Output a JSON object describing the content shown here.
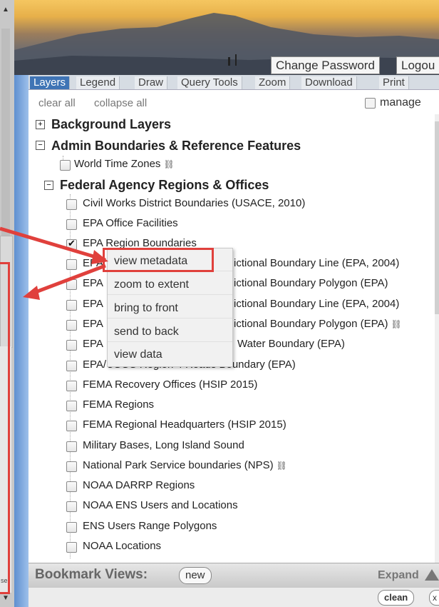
{
  "header": {
    "change_password": "Change Password",
    "logout": "Logou"
  },
  "tabs": [
    "Layers",
    "Legend",
    "Draw",
    "Query Tools",
    "Zoom",
    "Download",
    "Print"
  ],
  "toolbar": {
    "clear_all": "clear all",
    "collapse_all": "collapse all",
    "manage": "manage"
  },
  "tree": {
    "background_layers": "Background Layers",
    "admin_boundaries": "Admin Boundaries & Reference Features",
    "world_time_zones": "World Time Zones",
    "federal_agency": "Federal Agency Regions & Offices",
    "items": [
      "Civil Works District Boundaries (USACE, 2010)",
      "EPA Office Facilities",
      "EPA Region Boundaries",
      "EPA",
      "EPA",
      "EPA",
      "EPA",
      "EPA",
      "EPA/USGS Region 4 Roads Boundary (EPA)",
      "FEMA Recovery Offices (HSIP 2015)",
      "FEMA Regions",
      "FEMA Regional Headquarters (HSIP 2015)",
      "Military Bases, Long Island Sound",
      "National Park Service boundaries (NPS)",
      "NOAA DARRP Regions",
      "NOAA ENS Users and Locations",
      "ENS Users Range Polygons",
      "NOAA Locations"
    ],
    "partial_right": [
      "ictional Boundary Line (EPA, 2004)",
      "ictional Boundary Polygon (EPA)",
      "ictional Boundary Line (EPA, 2004)",
      "ictional Boundary Polygon (EPA)",
      "Water Boundary (EPA)"
    ]
  },
  "context_menu": [
    "view metadata",
    "zoom to extent",
    "bring to front",
    "send to back",
    "view data"
  ],
  "bookmark": {
    "title": "Bookmark Views:",
    "new": "new",
    "expand": "Expand"
  },
  "footer": {
    "clean": "clean",
    "x": "x"
  },
  "left_strip_text": "se",
  "colors": {
    "active_tab": "#3f74b5",
    "annotation_red": "#e0403c"
  }
}
